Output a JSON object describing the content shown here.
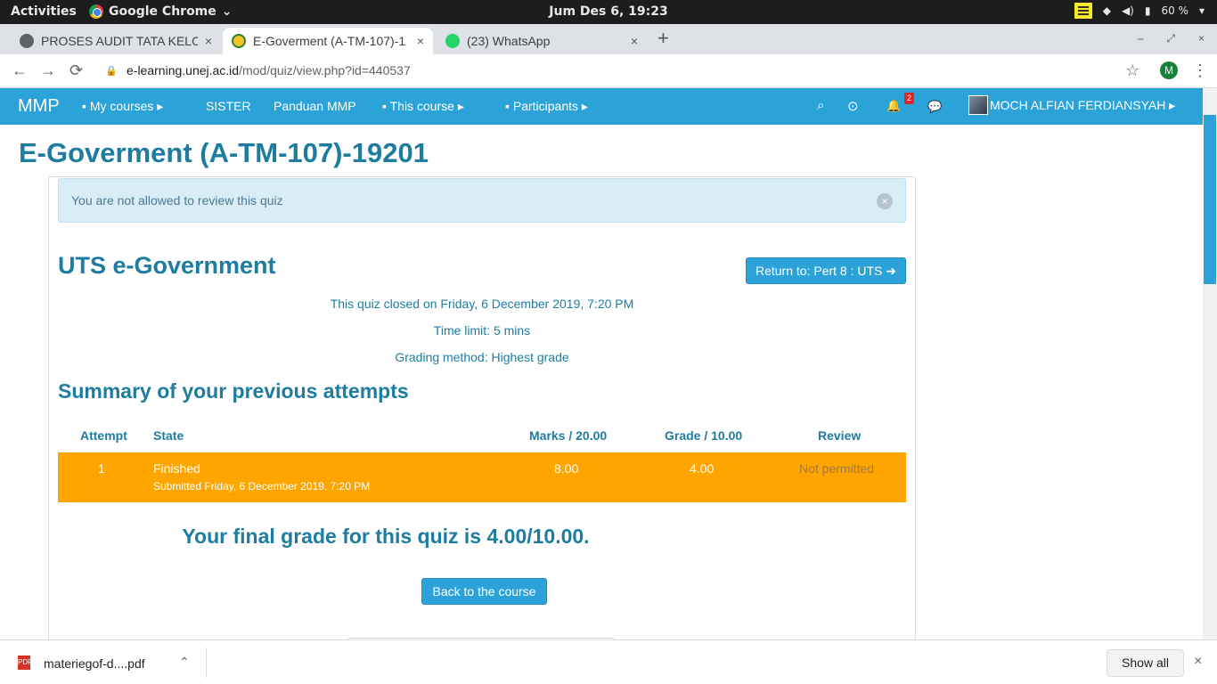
{
  "system": {
    "activities": "Activities",
    "app_name": "Google Chrome",
    "app_chevron": "⌄",
    "clock": "Jum Des  6, 19:23",
    "battery": "60 %",
    "wifi_glyph": "◆",
    "volume_glyph": "◀)",
    "battery_glyph": "▮",
    "menu_glyph": "▾"
  },
  "tabs": [
    {
      "title": "PROSES AUDIT TATA KELO",
      "close": "×",
      "icon": "globe-icon"
    },
    {
      "title": "E-Goverment (A-TM-107)-1",
      "close": "×",
      "icon": "unej-logo-icon"
    },
    {
      "title": "(23) WhatsApp",
      "close": "×",
      "icon": "whatsapp-icon"
    }
  ],
  "tabbar": {
    "new_tab": "+",
    "minimize": "–",
    "restore": "⤢",
    "close": "×"
  },
  "address": {
    "back": "←",
    "forward": "→",
    "reload": "⟳",
    "lock": "🔒",
    "host": "e-learning.unej.ac.id",
    "path": "/mod/quiz/view.php?id=440537",
    "star": "☆",
    "profile_initial": "M",
    "menu": "⋮"
  },
  "navbar": {
    "brand": "MMP",
    "my_courses": "My courses ▸",
    "sister": "SISTER",
    "panduan": "Panduan MMP",
    "this_course": "This course ▸",
    "participants": "Participants ▸",
    "search_glyph": "⌕",
    "grade_glyph": "⊙",
    "bell_glyph": "🔔",
    "message_glyph": "💬",
    "notification_count": "2",
    "user_name": "MOCH ALFIAN FERDIANSYAH ▸"
  },
  "page": {
    "course_title": "E-Goverment (A-TM-107)-19201",
    "alert_text": "You are not allowed to review this quiz",
    "alert_close": "×",
    "quiz_title": "UTS e-Government",
    "return_button": "Return to: Pert 8 : UTS ➜",
    "closed_info": "This quiz closed on Friday, 6 December 2019, 7:20 PM",
    "time_limit": "Time limit: 5 mins",
    "grading_method": "Grading method: Highest grade",
    "summary_heading": "Summary of your previous attempts",
    "final_grade": "Your final grade for this quiz is 4.00/10.00.",
    "back_button": "Back to the course"
  },
  "table": {
    "headers": [
      "Attempt",
      "State",
      "Marks / 20.00",
      "Grade / 10.00",
      "Review"
    ],
    "rows": [
      {
        "attempt": "1",
        "state": "Finished",
        "submitted": "Submitted Friday, 6 December 2019, 7:20 PM",
        "marks": "8.00",
        "grade": "4.00",
        "review": "Not permitted"
      }
    ]
  },
  "download": {
    "file": "materiegof-d....pdf",
    "file_type": "PDF",
    "chevron": "⌃",
    "show_all": "Show all",
    "close": "×"
  },
  "colors": {
    "brand": "#2ba3d9",
    "heading": "#1e7ca0",
    "row_highlight": "#ffa500",
    "alert_bg": "#d9edf7"
  }
}
